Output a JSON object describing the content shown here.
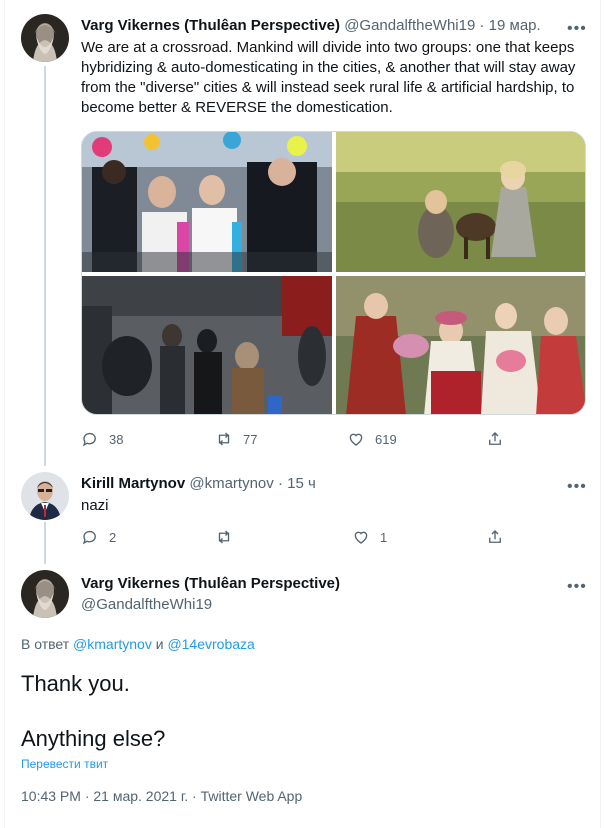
{
  "tweet1": {
    "display_name": "Varg Vikernes (Thulêan Perspective)",
    "handle": "@GandalftheWhi19",
    "dot": "·",
    "time": "19 мар.",
    "more": "•••",
    "text": "We are at a crossroad. Mankind will divide into two groups: one that keeps hybridizing & auto-domesticating in the cities, & another that will stay away from the \"diverse\" cities & will instead seek rural life & artificial hardship, to become better & REVERSE the domestication.",
    "replies": "38",
    "retweets": "77",
    "likes": "619"
  },
  "tweet2": {
    "display_name": "Kirill Martynov",
    "handle": "@kmartynov",
    "dot": "·",
    "time": "15 ч",
    "more": "•••",
    "text": "nazi",
    "replies": "2",
    "retweets": "",
    "likes": "1"
  },
  "main_tweet": {
    "display_name": "Varg Vikernes (Thulêan Perspective)",
    "handle": "@GandalftheWhi19",
    "more": "•••",
    "reply_prefix": "В ответ",
    "reply_mention_1": "@kmartynov",
    "reply_conj": "и",
    "reply_mention_2": "@14evrobaza",
    "line1": "Thank you.",
    "line2": "Anything else?",
    "translate": "Перевести твит",
    "timestamp": "10:43 PM · 21 мар. 2021 г. · ",
    "client": "Twitter Web App"
  },
  "colors": {
    "accent": "#1d9bf0",
    "secondary_text": "#536471",
    "primary_text": "#0f1419",
    "thread_line": "#cfd9de"
  },
  "icons": [
    "reply-icon",
    "retweet-icon",
    "like-icon",
    "share-icon",
    "more-icon"
  ]
}
